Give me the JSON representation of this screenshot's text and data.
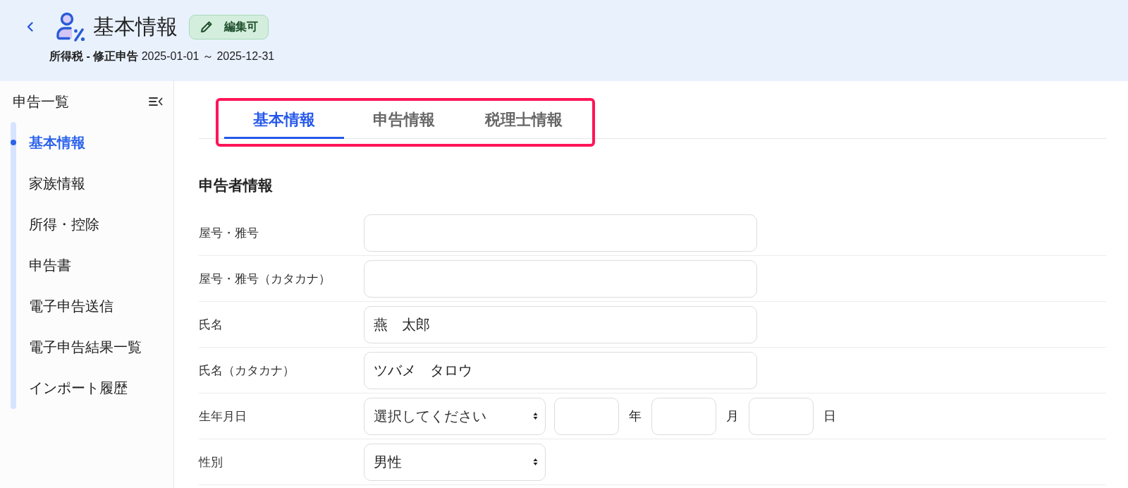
{
  "header": {
    "title": "基本情報",
    "badge": {
      "label": "編集可"
    },
    "subtitle": "**所得税 - 修正申告** 2025-01-01 ～ 2025-12-31"
  },
  "sidebar": {
    "title": "申告一覧",
    "items": [
      {
        "label": "基本情報",
        "selected": true
      },
      {
        "label": "家族情報",
        "selected": false
      },
      {
        "label": "所得・控除",
        "selected": false
      },
      {
        "label": "申告書",
        "selected": false
      },
      {
        "label": "電子申告送信",
        "selected": false
      },
      {
        "label": "電子申告結果一覧",
        "selected": false
      },
      {
        "label": "インポート履歴",
        "selected": false
      }
    ]
  },
  "tabs": {
    "highlighted": true,
    "items": [
      {
        "label": "基本情報",
        "selected": true
      },
      {
        "label": "申告情報",
        "selected": false
      },
      {
        "label": "税理士情報",
        "selected": false
      }
    ]
  },
  "section": {
    "title": "申告者情報",
    "rows": [
      {
        "kind": "text",
        "label": "屋号・雅号"
      },
      {
        "kind": "text",
        "label": "屋号・雅号（カタカナ）"
      },
      {
        "kind": "text",
        "label": "氏名",
        "value": "燕　太郎"
      },
      {
        "kind": "text",
        "label": "氏名（カタカナ）",
        "value": "ツバメ　タロウ"
      },
      {
        "kind": "date",
        "label": "生年月日",
        "dropdown": {
          "placeholder": "選択してください"
        },
        "parts": [
          {
            "unit": "年"
          },
          {
            "unit": "月"
          },
          {
            "unit": "日"
          }
        ]
      },
      {
        "kind": "select",
        "label": "性別",
        "value": "男性"
      }
    ]
  }
}
